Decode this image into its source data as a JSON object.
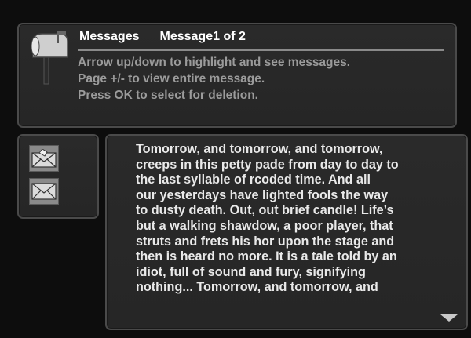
{
  "header": {
    "title": "Messages",
    "counter": "Message1 of 2",
    "instructions": [
      "Arrow up/down to highlight and see messages.",
      "Page +/- to view entire message.",
      "Press OK to select for deletion."
    ],
    "icon": "mailbox-icon"
  },
  "message_list": {
    "items": [
      {
        "icon": "opened-envelope-icon",
        "state": "selected"
      },
      {
        "icon": "closed-envelope-icon",
        "state": "unread"
      }
    ]
  },
  "message": {
    "lines": [
      "Tomorrow, and tomorrow, and tomorrow,",
      "creeps in this petty pade from day to day to",
      "the last syllable of rcoded time. And all",
      "our yesterdays have lighted fools the way",
      "to dusty death. Out, out brief candle! Life’s",
      "but a walking shawdow, a poor player, that",
      "struts and frets his hor upon the stage and",
      "then is heard no more. It is a tale told by an",
      "idiot, full of sound and fury, signifying",
      "nothing... Tomorrow, and tomorrow, and"
    ],
    "scroll_icon": "scroll-down-arrow-icon"
  }
}
